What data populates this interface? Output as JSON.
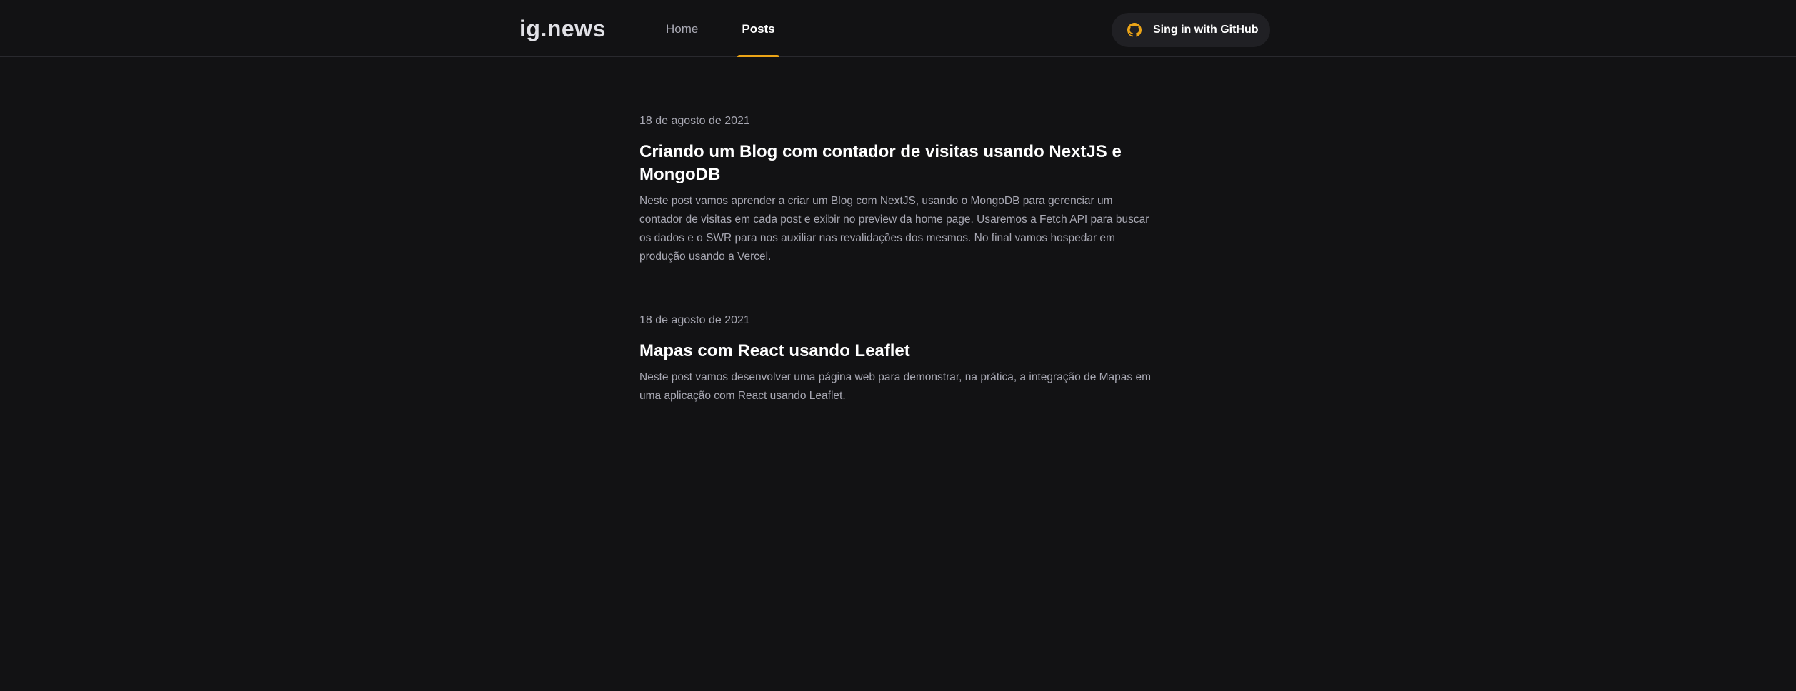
{
  "header": {
    "logo": "ig.news",
    "nav": [
      {
        "label": "Home",
        "active": false
      },
      {
        "label": "Posts",
        "active": true
      }
    ],
    "signin": {
      "label": "Sing in with GitHub",
      "icon": "github-icon",
      "icon_color": "#eba417"
    }
  },
  "posts": [
    {
      "date": "18 de agosto de 2021",
      "title": "Criando um Blog com contador de visitas usando NextJS e MongoDB",
      "excerpt": "Neste post vamos aprender a criar um Blog com NextJS, usando o MongoDB para gerenciar um contador de visitas em cada post e exibir no preview da home page. Usaremos a Fetch API para buscar os dados e o SWR para nos auxiliar nas revalidações dos mesmos. No final vamos hospedar em produção usando a Vercel."
    },
    {
      "date": "18 de agosto de 2021",
      "title": "Mapas com React usando Leaflet",
      "excerpt": "Neste post vamos desenvolver uma página web para demonstrar, na prática, a integração de Mapas em uma aplicação com React usando Leaflet."
    }
  ],
  "colors": {
    "background": "#121214",
    "accent": "#eba417",
    "button_bg": "#202024",
    "text_muted": "#a8a8b3"
  }
}
